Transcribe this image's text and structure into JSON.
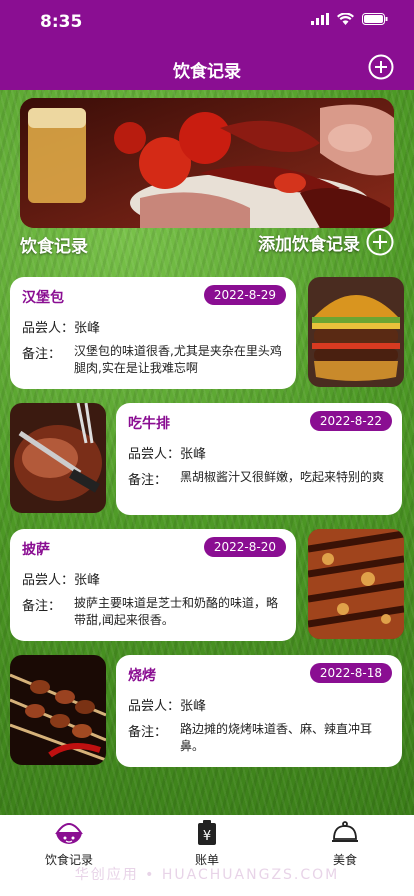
{
  "status": {
    "time": "8:35"
  },
  "nav": {
    "title": "饮食记录"
  },
  "banner": {
    "label": "饮食记录",
    "add_label": "添加饮食记录"
  },
  "records": [
    {
      "name": "汉堡包",
      "date": "2022-8-29",
      "taster_label": "品尝人：",
      "taster": "张峰",
      "note_label": "备注：",
      "note": "汉堡包的味道很香,尤其是夹杂在里头鸡腿肉,实在是让我难忘啊"
    },
    {
      "name": "吃牛排",
      "date": "2022-8-22",
      "taster_label": "品尝人：",
      "taster": "张峰",
      "note_label": "备注：",
      "note": "黑胡椒酱汁又很鲜嫩，吃起来特别的爽"
    },
    {
      "name": "披萨",
      "date": "2022-8-20",
      "taster_label": "品尝人：",
      "taster": "张峰",
      "note_label": "备注：",
      "note": "披萨主要味道是芝士和奶酪的味道，略带甜,闻起来很香。"
    },
    {
      "name": "烧烤",
      "date": "2022-8-18",
      "taster_label": "品尝人：",
      "taster": "张峰",
      "note_label": "备注：",
      "note": "路边摊的烧烤味道香、麻、辣直冲耳鼻。"
    }
  ],
  "tabs": [
    {
      "label": "饮食记录",
      "icon": "bowl-icon"
    },
    {
      "label": "账单",
      "icon": "bill-icon"
    },
    {
      "label": "美食",
      "icon": "cloche-icon"
    }
  ],
  "watermark": "华创应用 • HUACHUANGZS.COM",
  "colors": {
    "accent": "#8a0e92"
  }
}
